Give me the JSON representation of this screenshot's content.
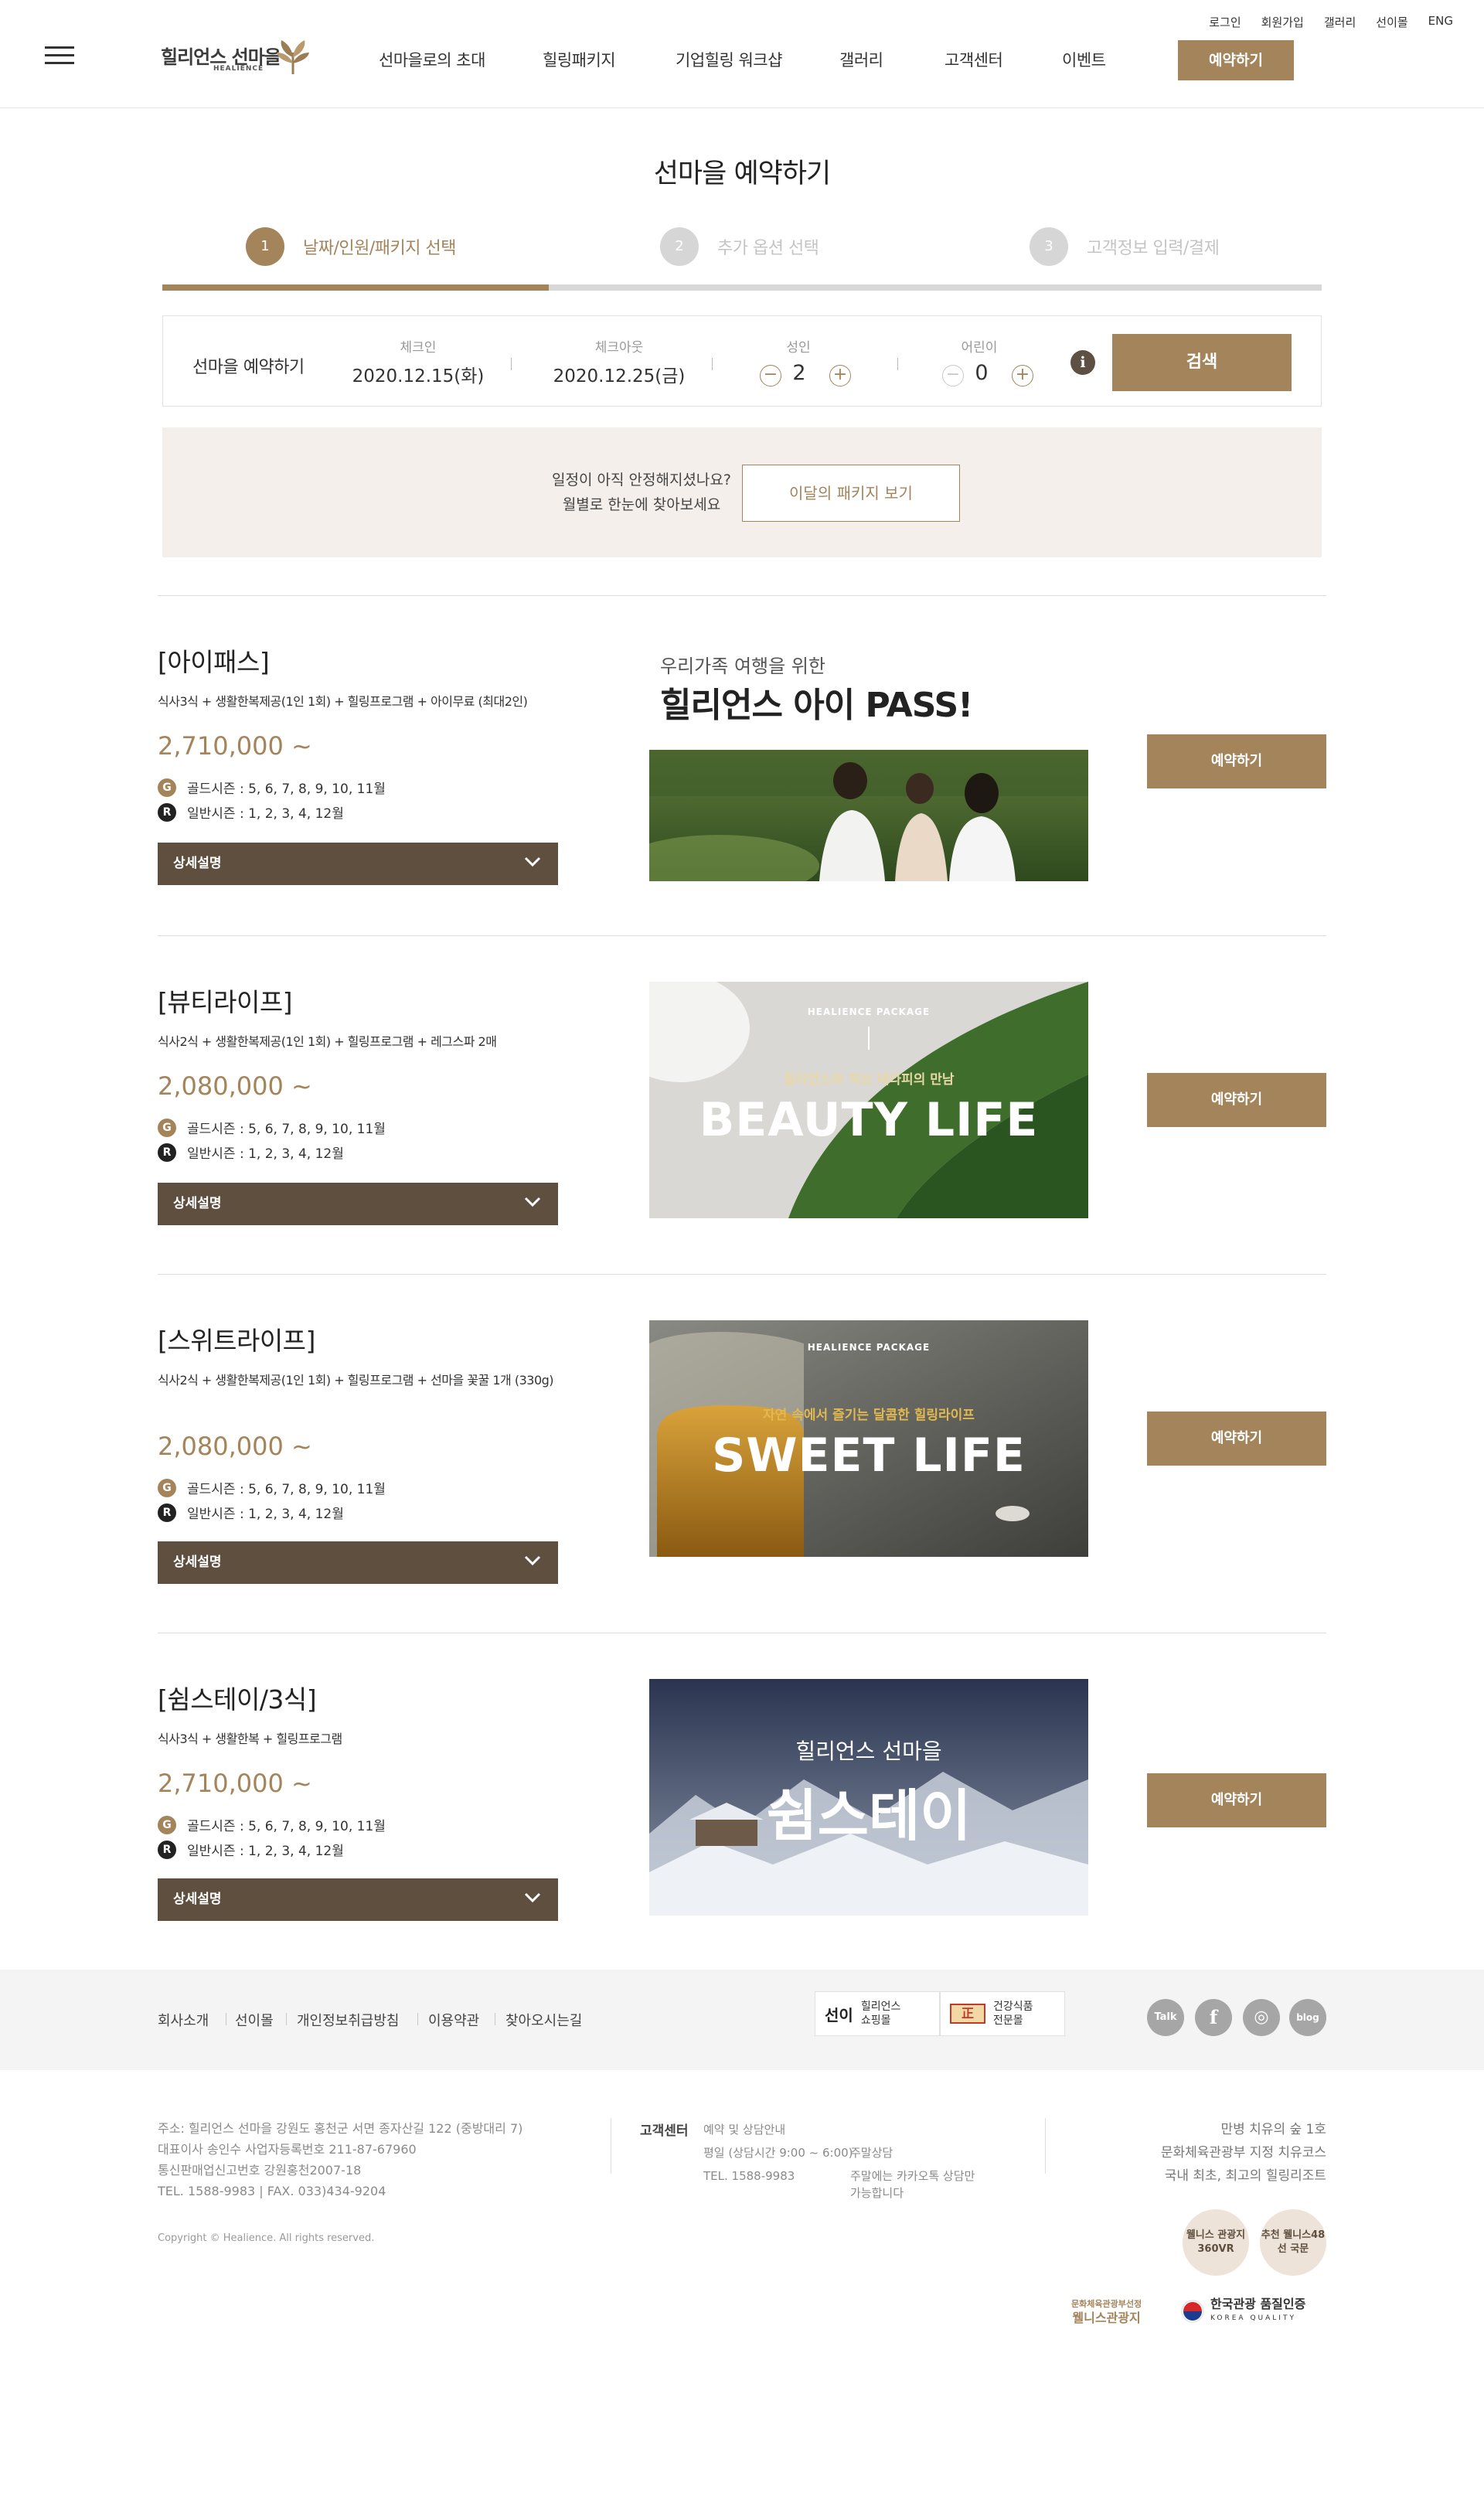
{
  "header": {
    "logo_ko": "힐리언스 선마을",
    "logo_en": "HEALIENCE",
    "nav": [
      "선마을로의 초대",
      "힐링패키지",
      "기업힐링 워크샵",
      "갤러리",
      "고객센터",
      "이벤트"
    ],
    "reserve": "예약하기",
    "utils": [
      "로그인",
      "회원가입",
      "갤러리",
      "선이몰",
      "ENG"
    ]
  },
  "page_title": "선마을 예약하기",
  "steps": [
    {
      "num": "1",
      "label": "날짜/인원/패키지 선택"
    },
    {
      "num": "2",
      "label": "추가 옵션 선택"
    },
    {
      "num": "3",
      "label": "고객정보 입력/결제"
    }
  ],
  "search": {
    "title": "선마을 예약하기",
    "checkin_label": "체크인",
    "checkin_value": "2020.12.15(화)",
    "checkout_label": "체크아웃",
    "checkout_value": "2020.12.25(금)",
    "adult_label": "성인",
    "adult_count": "2",
    "child_label": "어린이",
    "child_count": "0",
    "minus": "−",
    "plus": "+",
    "info": "i",
    "button": "검색"
  },
  "notice": {
    "line1": "일정이 아직 안정해지셨나요?",
    "line2": "월별로 한눈에 찾아보세요",
    "button": "이달의 패키지 보기"
  },
  "packages": [
    {
      "title": "[아이패스]",
      "desc": "식사3식 + 생활한복제공(1인 1회) + 힐링프로그램 + 아이무료 (최대2인)",
      "price": "2,710,000 ~",
      "gold": "골드시즌 : 5, 6, 7, 8, 9, 10, 11월",
      "regular": "일반시즌 : 1, 2, 3, 4, 12월",
      "detail": "상세설명",
      "reserve": "예약하기",
      "img_sub": "우리가족 여행을 위한",
      "img_main": "힐리언스 아이 PASS!"
    },
    {
      "title": "[뷰티라이프]",
      "desc": "식사2식 + 생활한복제공(1인 1회) + 힐링프로그램 + 레그스파 2매",
      "price": "2,080,000 ~",
      "gold": "골드시즌 : 5, 6, 7, 8, 9, 10, 11월",
      "regular": "일반시즌 : 1, 2, 3, 4, 12월",
      "detail": "상세설명",
      "reserve": "예약하기",
      "img_tag": "HEALIENCE PACKAGE",
      "img_sub": "힐리언스와 허브 테라피의 만남",
      "img_main": "BEAUTY LIFE"
    },
    {
      "title": "[스위트라이프]",
      "desc": "식사2식 + 생활한복제공(1인 1회) + 힐링프로그램 + 선마을 꽃꿀 1개 (330g)",
      "price": "2,080,000 ~",
      "gold": "골드시즌 : 5, 6, 7, 8, 9, 10, 11월",
      "regular": "일반시즌 : 1, 2, 3, 4, 12월",
      "detail": "상세설명",
      "reserve": "예약하기",
      "img_tag": "HEALIENCE PACKAGE",
      "img_sub": "자연 속에서 즐기는 달콤한 힐링라이프",
      "img_main": "SWEET LIFE"
    },
    {
      "title": "[쉼스테이/3식]",
      "desc": "식사3식 + 생활한복 + 힐링프로그램",
      "price": "2,710,000 ~",
      "gold": "골드시즌 : 5, 6, 7, 8, 9, 10, 11월",
      "regular": "일반시즌 : 1, 2, 3, 4, 12월",
      "detail": "상세설명",
      "reserve": "예약하기",
      "img_sub": "힐리언스 선마을",
      "img_main": "쉼스테이"
    }
  ],
  "season_badges": {
    "gold": "G",
    "regular": "R"
  },
  "footer": {
    "links": [
      "회사소개",
      "선이몰",
      "개인정보취급방침",
      "이용약관",
      "찾아오시는길"
    ],
    "badge1_logo": "선이",
    "badge1_text1": "힐리언스",
    "badge1_text2": "쇼핑몰",
    "badge2_logo": "正",
    "badge2_text1": "건강식품",
    "badge2_text2": "전문몰",
    "sns": [
      "Talk",
      "f",
      "◎",
      "blog"
    ],
    "address": "주소: 힐리언스 선마을 강원도 홍천군 서면 종자산길 122 (중방대리 7)",
    "ceo": "대표이사 송인수 사업자등록번호 211-87-67960",
    "license": "통신판매업신고번호 강원홍천2007-18",
    "tel": "TEL. 1588-9983 | FAX. 033)434-9204",
    "copyright": "Copyright © Healience. All rights reserved.",
    "cs_title": "고객센터",
    "cs_reserve": "예약 및 상담안내",
    "cs_weekday": "평일 (상담시간 9:00 ~ 6:00)",
    "cs_tel": "TEL. 1588-9983",
    "cs_weekend": "주말상담",
    "cs_kakao": "주말에는 카카오톡 상담만",
    "cs_kakao2": "가능합니다",
    "right1": "만병 치유의 숲 1호",
    "right2": "문화체육관광부 지정 치유코스",
    "right3": "국내 최초, 최고의 힐링리조트",
    "round1": "웰니스 관광지 360VR",
    "round2": "추천 웰니스48선 국문",
    "cert1_top": "문화체육관광부선정",
    "cert1_main": "웰니스관광지",
    "cert2_main": "한국관광 품질인증",
    "cert2_sub": "KOREA QUALITY"
  },
  "colors": {
    "accent": "#a4845a",
    "dark": "#5e4f3f",
    "notice_bg": "#f4efea"
  }
}
